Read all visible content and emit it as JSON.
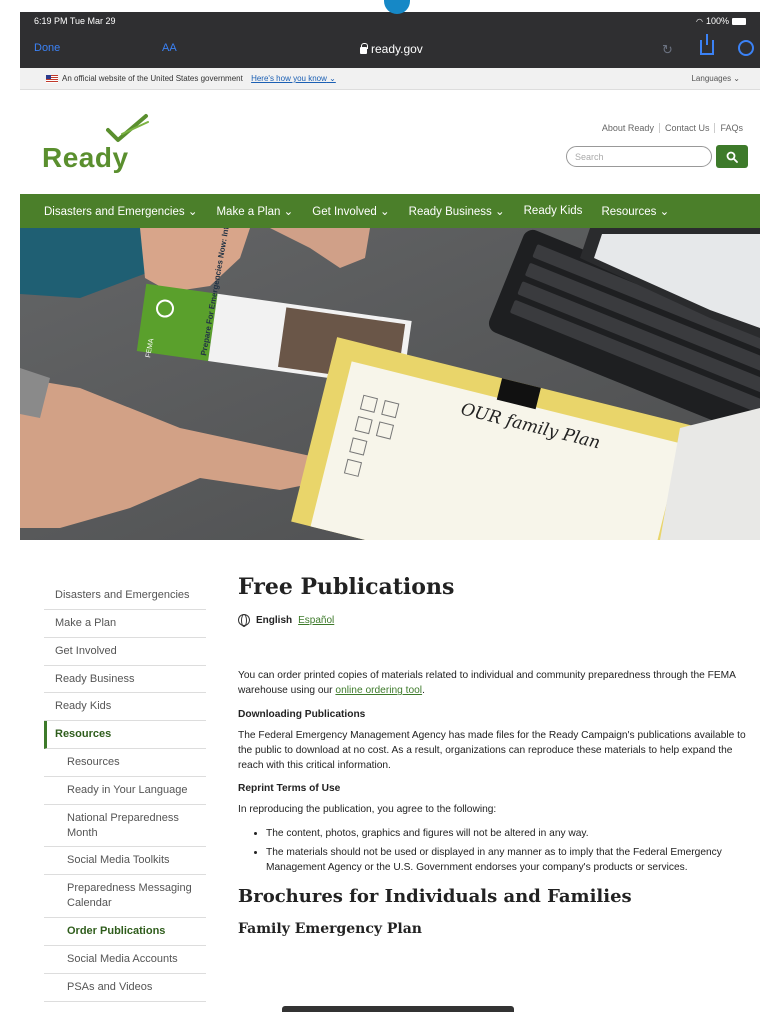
{
  "status_bar": {
    "time": "6:19 PM  Tue Mar 29",
    "battery": "100%"
  },
  "browser": {
    "done_label": "Done",
    "text_size_label": "AA",
    "url": "ready.gov"
  },
  "gov_banner": {
    "text": "An official website of the United States government",
    "link": "Here's how you know",
    "languages": "Languages"
  },
  "header": {
    "logo": "Ready",
    "util_links": [
      "About Ready",
      "Contact Us",
      "FAQs"
    ],
    "search_placeholder": "Search"
  },
  "nav": {
    "items": [
      "Disasters and Emergencies",
      "Make a Plan",
      "Get Involved",
      "Ready Business",
      "Ready Kids",
      "Resources"
    ]
  },
  "hero": {
    "brochure_text": "Prepare For Emergencies Now: Information for Older Americans",
    "fema_label": "FEMA",
    "plan_heading": "OUR family Plan"
  },
  "sidebar": {
    "items": [
      "Disasters and Emergencies",
      "Make a Plan",
      "Get Involved",
      "Ready Business",
      "Ready Kids",
      "Resources"
    ],
    "subitems": [
      "Resources",
      "Ready in Your Language",
      "National Preparedness Month",
      "Social Media Toolkits",
      "Preparedness Messaging Calendar",
      "Order Publications",
      "Social Media Accounts",
      "PSAs and Videos"
    ]
  },
  "main": {
    "title": "Free Publications",
    "lang_current": "English",
    "lang_alt": "Español",
    "intro_pre": "You can order printed copies of materials related to individual and community preparedness through the FEMA warehouse using our ",
    "intro_link": "online ordering tool",
    "intro_post": ".",
    "download_head": "Downloading Publications",
    "download_text": "The Federal Emergency Management Agency has made files for the Ready Campaign's publications available to the public to download at no cost. As a result, organizations can reproduce these materials to help expand the reach with this critical information.",
    "reprint_head": "Reprint Terms of Use",
    "reprint_text": "In reproducing the publication, you agree to the following:",
    "bullets": [
      "The content, photos, graphics and figures will not be altered in any way.",
      "The materials should not be used or displayed in any manner as to imply that the Federal Emergency Management Agency or the U.S. Government endorses your company's products or services."
    ],
    "brochures_head": "Brochures for Individuals and Families",
    "family_head": "Family Emergency Plan"
  },
  "colors": {
    "brand_green": "#4b7f2a",
    "link_green": "#3d7a2a",
    "chrome_dark": "#2f2f31",
    "safari_blue": "#3b82f6"
  }
}
